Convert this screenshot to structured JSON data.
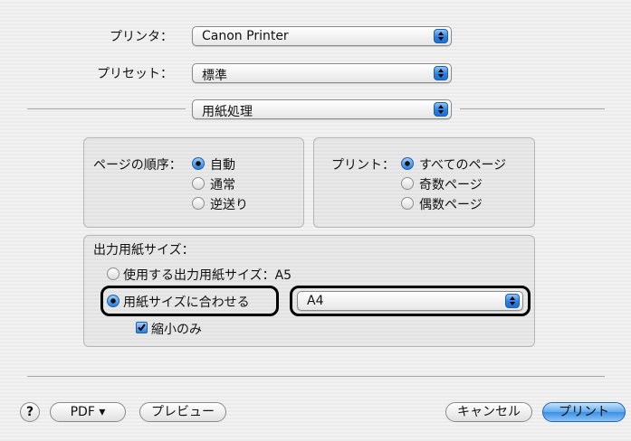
{
  "printer": {
    "label": "プリンタ：",
    "value": "Canon Printer"
  },
  "preset": {
    "label": "プリセット：",
    "value": "標準"
  },
  "panel": {
    "value": "用紙処理"
  },
  "page_order": {
    "label": "ページの順序：",
    "options": [
      "自動",
      "通常",
      "逆送り"
    ],
    "selected": "自動"
  },
  "print_pages": {
    "label": "プリント：",
    "options": [
      "すべてのページ",
      "奇数ページ",
      "偶数ページ"
    ],
    "selected": "すべてのページ"
  },
  "paper_size": {
    "title": "出力用紙サイズ：",
    "option_use": "使用する出力用紙サイズ：A5",
    "option_fit": "用紙サイズに合わせる",
    "selected": "用紙サイズに合わせる",
    "fit_size": "A4",
    "scale_down_only_label": "縮小のみ",
    "scale_down_only_checked": true
  },
  "footer": {
    "help": "?",
    "pdf": "PDF ▾",
    "preview": "プレビュー",
    "cancel": "キャンセル",
    "print": "プリント"
  },
  "colors": {
    "accent": "#2a7fe0",
    "highlight_border": "#000000"
  }
}
